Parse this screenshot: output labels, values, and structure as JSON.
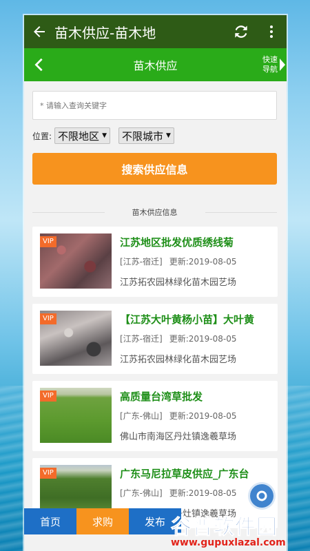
{
  "appbar": {
    "title": "苗木供应-苗木地"
  },
  "subbar": {
    "title": "苗木供应",
    "quick_nav": "快速导航"
  },
  "search": {
    "placeholder": "* 请输入查询关键字"
  },
  "location": {
    "label": "位置:",
    "region": "不限地区",
    "city": "不限城市"
  },
  "search_button": "搜索供应信息",
  "section_title": "苗木供应信息",
  "listings": [
    {
      "badge": "VIP",
      "title": "江苏地区批发优质绣线菊",
      "location": "[江苏-宿迁]",
      "updated": "更新:2019-08-05",
      "company": "江苏拓农园林绿化苗木园艺场"
    },
    {
      "badge": "VIP",
      "title": "【江苏大叶黄杨小苗】大叶黄",
      "location": "[江苏-宿迁]",
      "updated": "更新:2019-08-05",
      "company": "江苏拓农园林绿化苗木园艺场"
    },
    {
      "badge": "VIP",
      "title": "高质量台湾草批发",
      "location": "[广东-佛山]",
      "updated": "更新:2019-08-05",
      "company": "佛山市南海区丹灶镇逸羲草场"
    },
    {
      "badge": "VIP",
      "title": "广东马尼拉草皮供应_广东台",
      "location": "[广东-佛山]",
      "updated": "更新:2019-08-05",
      "company": "佛山市南海区丹灶镇逸羲草场"
    }
  ],
  "tabs": [
    {
      "label": "首页",
      "color": "#1e6fc6"
    },
    {
      "label": "求购",
      "color": "#f7931e"
    },
    {
      "label": "发布",
      "color": "#1e6fc6"
    }
  ],
  "watermark": {
    "logo": "谷普软件园",
    "url": "www.gupuxlazal.com"
  },
  "colors": {
    "appbar": "#2e5b16",
    "subbar": "#2aab19",
    "accent": "#f7931e",
    "title_green": "#1f8f19",
    "vip": "#f36b2a"
  },
  "icons": {
    "back": "arrow-left-icon",
    "refresh": "refresh-icon",
    "more": "more-vert-icon",
    "sub_back": "chevron-left-icon",
    "quick": "triangle-right-icon"
  }
}
